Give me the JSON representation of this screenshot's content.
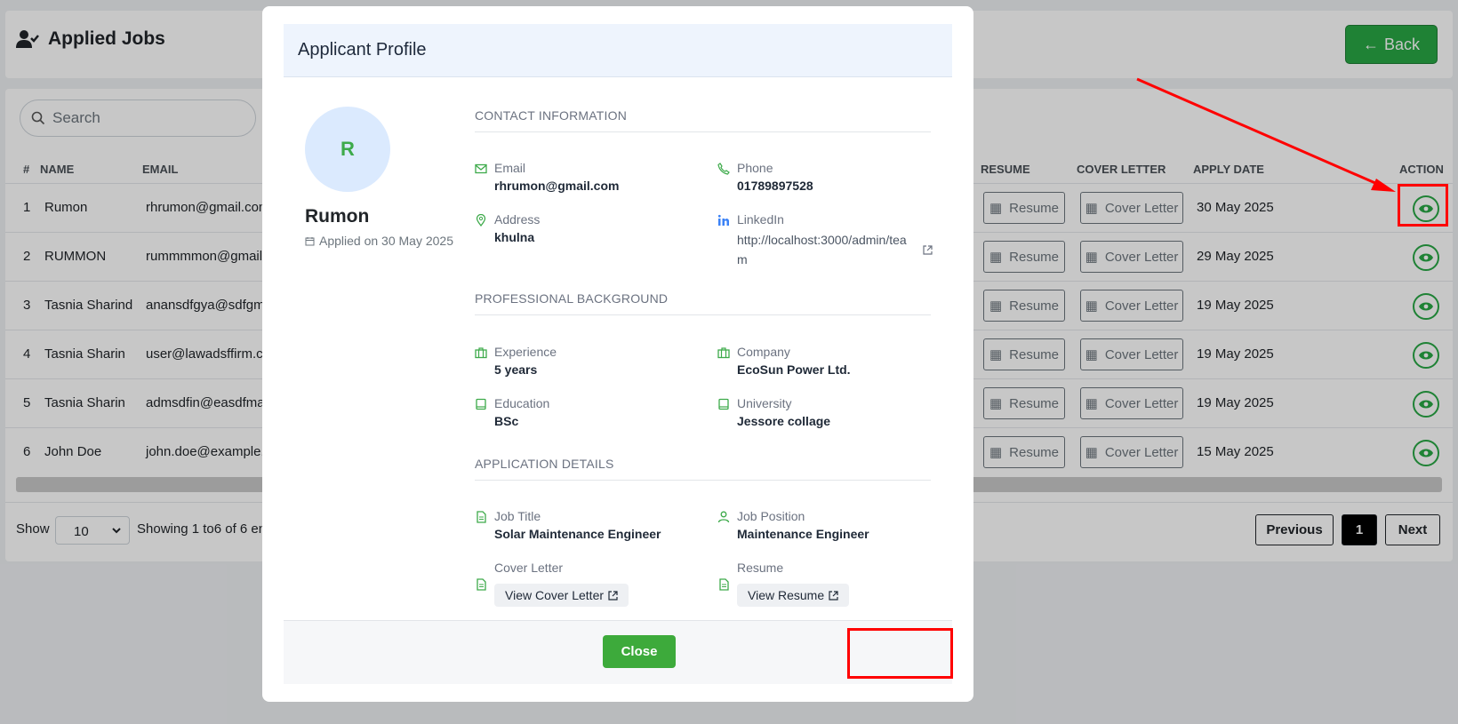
{
  "header": {
    "title": "Applied Jobs",
    "back_label": "Back"
  },
  "search": {
    "placeholder": "Search"
  },
  "table": {
    "columns": [
      "#",
      "NAME",
      "EMAIL",
      "RESUME",
      "COVER LETTER",
      "APPLY DATE",
      "ACTION"
    ],
    "rows": [
      {
        "n": "1",
        "name": "Rumon",
        "email": "rhrumon@gmail.com",
        "resume": "Resume",
        "cover": "Cover Letter",
        "date": "30 May 2025"
      },
      {
        "n": "2",
        "name": "RUMMON",
        "email": "rummmmon@gmail.",
        "resume": "Resume",
        "cover": "Cover Letter",
        "date": "29 May 2025"
      },
      {
        "n": "3",
        "name": "Tasnia Sharind",
        "email": "anansdfgya@sdfgm",
        "resume": "Resume",
        "cover": "Cover Letter",
        "date": "19 May 2025"
      },
      {
        "n": "4",
        "name": "Tasnia Sharin",
        "email": "user@lawadsffirm.c",
        "resume": "Resume",
        "cover": "Cover Letter",
        "date": "19 May 2025"
      },
      {
        "n": "5",
        "name": "Tasnia Sharin",
        "email": "admsdfin@easdfma",
        "resume": "Resume",
        "cover": "Cover Letter",
        "date": "19 May 2025"
      },
      {
        "n": "6",
        "name": "John Doe",
        "email": "john.doe@example.",
        "resume": "Resume",
        "cover": "Cover Letter",
        "date": "15 May 2025"
      }
    ]
  },
  "footer": {
    "show_label": "Show",
    "page_size": "10",
    "showing_text": "Showing 1  to6  of 6 en",
    "previous": "Previous",
    "page": "1",
    "next": "Next"
  },
  "modal": {
    "title": "Applicant Profile",
    "avatar_letter": "R",
    "name": "Rumon",
    "applied": "Applied on 30 May 2025",
    "contact_heading": "CONTACT INFORMATION",
    "email_label": "Email",
    "email": "rhrumon@gmail.com",
    "phone_label": "Phone",
    "phone": "01789897528",
    "address_label": "Address",
    "address": "khulna",
    "linkedin_label": "LinkedIn",
    "linkedin": "http://localhost:3000/admin/team",
    "professional_heading": "PROFESSIONAL BACKGROUND",
    "experience_label": "Experience",
    "experience": "5 years",
    "company_label": "Company",
    "company": "EcoSun Power Ltd.",
    "education_label": "Education",
    "education": "BSc",
    "university_label": "University",
    "university": "Jessore collage",
    "application_heading": "APPLICATION DETAILS",
    "job_title_label": "Job Title",
    "job_title": "Solar Maintenance Engineer",
    "job_position_label": "Job Position",
    "job_position": "Maintenance Engineer",
    "cover_letter_label": "Cover Letter",
    "cover_letter_btn": "View Cover Letter",
    "resume_label": "Resume",
    "resume_btn": "View Resume",
    "close_label": "Close"
  },
  "colors": {
    "accent": "#28a745",
    "annotation": "#ff0000"
  }
}
